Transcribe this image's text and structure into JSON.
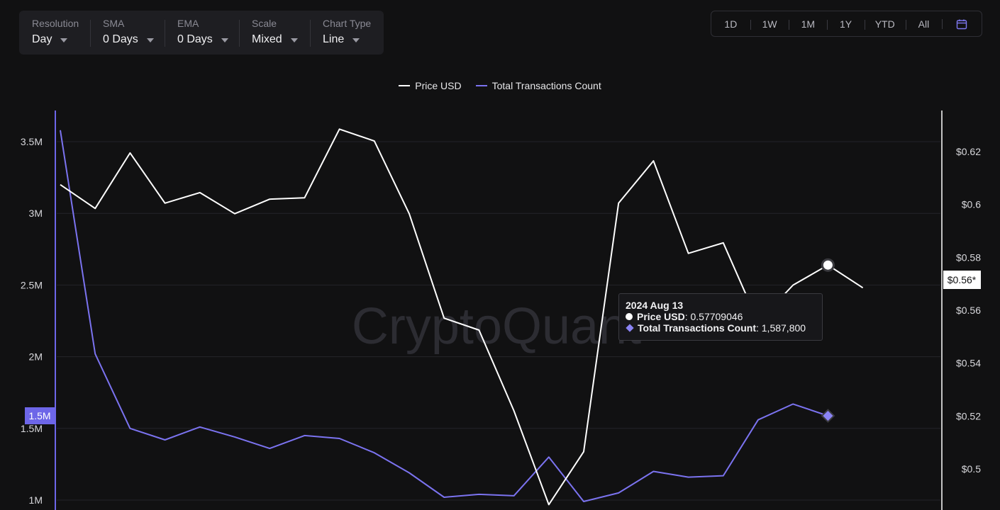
{
  "toolbar": {
    "controls": [
      {
        "label": "Resolution",
        "value": "Day"
      },
      {
        "label": "SMA",
        "value": "0 Days"
      },
      {
        "label": "EMA",
        "value": "0 Days"
      },
      {
        "label": "Scale",
        "value": "Mixed"
      },
      {
        "label": "Chart Type",
        "value": "Line"
      }
    ]
  },
  "ranges": [
    "1D",
    "1W",
    "1M",
    "1Y",
    "YTD",
    "All"
  ],
  "watermark": "CryptoQuant",
  "colors": {
    "price": "#ffffff",
    "tx": "#7b73f0",
    "background": "#111112"
  },
  "tooltip": {
    "date": "2024 Aug 13",
    "price_label": "Price USD",
    "price_value": "0.57709046",
    "tx_label": "Total Transactions Count",
    "tx_value": "1,587,800"
  },
  "axis_tags": {
    "left": "1.5M",
    "right": "$0.56*"
  },
  "chart_data": {
    "type": "line",
    "legend": [
      "Price USD",
      "Total Transactions Count"
    ],
    "legend_position": "top-center",
    "grid": true,
    "x_index": [
      1,
      2,
      3,
      4,
      5,
      6,
      7,
      8,
      9,
      10,
      11,
      12,
      13,
      14,
      15,
      16,
      17,
      18,
      19,
      20,
      21,
      22,
      23,
      24,
      25,
      26,
      27,
      28,
      29
    ],
    "series": [
      {
        "name": "Price USD",
        "axis": "right",
        "values": [
          0.6075,
          0.5985,
          0.6195,
          0.6005,
          0.6045,
          0.5965,
          0.602,
          0.6025,
          0.6285,
          0.624,
          0.5965,
          0.557,
          0.5525,
          0.522,
          0.4865,
          0.5065,
          0.6005,
          0.6165,
          0.5815,
          0.5855,
          0.5555,
          0.5695,
          0.57709046,
          0.5685
        ]
      },
      {
        "name": "Total Transactions Count",
        "axis": "left",
        "values": [
          3580000,
          2020000,
          1500000,
          1420000,
          1510000,
          1440000,
          1360000,
          1450000,
          1430000,
          1330000,
          1190000,
          1020000,
          1040000,
          1030000,
          1300000,
          990000,
          1050000,
          1200000,
          1160000,
          1170000,
          1560000,
          1670000,
          1587800
        ]
      }
    ],
    "left_axis": {
      "ticks": [
        "1M",
        "1.5M",
        "2M",
        "2.5M",
        "3M",
        "3.5M"
      ],
      "values": [
        1000000,
        1500000,
        2000000,
        2500000,
        3000000,
        3500000
      ]
    },
    "right_axis": {
      "ticks": [
        "$0.5",
        "$0.52",
        "$0.54",
        "$0.56",
        "$0.58",
        "$0.6",
        "$0.62"
      ],
      "values": [
        0.5,
        0.52,
        0.54,
        0.56,
        0.58,
        0.6,
        0.62
      ]
    }
  }
}
